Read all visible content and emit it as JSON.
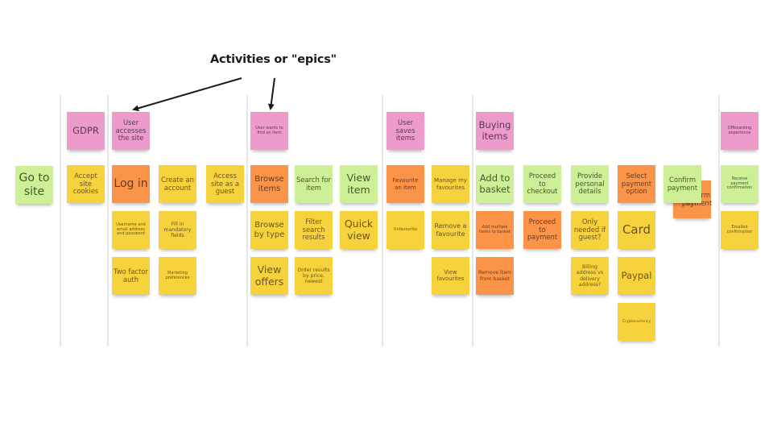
{
  "title": "Activities or \"epics\"",
  "epics": {
    "gdpr": "GDPR",
    "access": "User accesses the site",
    "find": "User wants to find an item",
    "save": "User saves items",
    "buy": "Buying items",
    "offboard": "Offboarding experience"
  },
  "notes": {
    "go_to_site": "Go to site",
    "accept_cookies": "Accept site cookies",
    "log_in": "Log in",
    "username": "Username and email address and password",
    "two_factor": "Two factor auth",
    "create_account": "Create an account",
    "fill_fields": "Fill in mandatory fields",
    "marketing": "Marketing preferences",
    "guest": "Access site as a guest",
    "browse_items": "Browse items",
    "browse_type": "Browse by type",
    "view_offers": "View offers",
    "search_item": "Search for item",
    "filter_results": "Filter search results",
    "order_results": "Order results by price, newest",
    "view_item": "View item",
    "quick_view": "Quick view",
    "favourite_item": "Favourite an item",
    "unfavourite": "Unfavourite",
    "manage_favourites": "Manage my favourites",
    "remove_favourite": "Remove a favourite",
    "view_favourites": "View favourites",
    "add_basket": "Add to basket",
    "add_multiple": "Add multiple items to basket",
    "remove_basket": "Remove item from basket",
    "proceed_checkout": "Proceed to checkout",
    "proceed_payment": "Proceed to payment",
    "personal_details": "Provide personal details",
    "only_guest": "Only needed if guest?",
    "billing": "Billing address vs delivery address?",
    "select_payment": "Select payment option",
    "card": "Card",
    "paypal": "Paypal",
    "crypto": "Cryptocurrency",
    "confirm_payment_hidden": "Confirm payment",
    "confirm_payment": "Confirm payment",
    "receive_confirmation": "Receive payment confirmation",
    "emailed_confirmation": "Emailed confirmation"
  }
}
